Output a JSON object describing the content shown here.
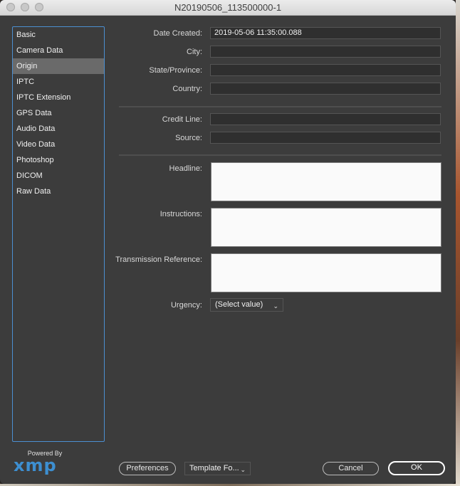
{
  "window": {
    "title": "N20190506_113500000-1"
  },
  "sidebar": {
    "items": [
      {
        "label": "Basic",
        "selected": false
      },
      {
        "label": "Camera Data",
        "selected": false
      },
      {
        "label": "Origin",
        "selected": true
      },
      {
        "label": "IPTC",
        "selected": false
      },
      {
        "label": "IPTC Extension",
        "selected": false
      },
      {
        "label": "GPS Data",
        "selected": false
      },
      {
        "label": "Audio Data",
        "selected": false
      },
      {
        "label": "Video Data",
        "selected": false
      },
      {
        "label": "Photoshop",
        "selected": false
      },
      {
        "label": "DICOM",
        "selected": false
      },
      {
        "label": "Raw Data",
        "selected": false
      }
    ]
  },
  "form": {
    "date_created": {
      "label": "Date Created:",
      "value": "2019-05-06 11:35:00.088"
    },
    "city": {
      "label": "City:",
      "value": ""
    },
    "state": {
      "label": "State/Province:",
      "value": ""
    },
    "country": {
      "label": "Country:",
      "value": ""
    },
    "credit_line": {
      "label": "Credit Line:",
      "value": ""
    },
    "source": {
      "label": "Source:",
      "value": ""
    },
    "headline": {
      "label": "Headline:",
      "value": ""
    },
    "instructions": {
      "label": "Instructions:",
      "value": ""
    },
    "transmission_reference": {
      "label": "Transmission Reference:",
      "value": ""
    },
    "urgency": {
      "label": "Urgency:",
      "value": "(Select value)"
    }
  },
  "footer": {
    "powered_by": "Powered By",
    "xmp_logo": "xmp",
    "preferences_label": "Preferences",
    "template_label": "Template Fo...",
    "cancel_label": "Cancel",
    "ok_label": "OK"
  },
  "colors": {
    "accent": "#4b8fd1",
    "panel": "#3c3c3c",
    "selected": "#6a6a6a"
  }
}
